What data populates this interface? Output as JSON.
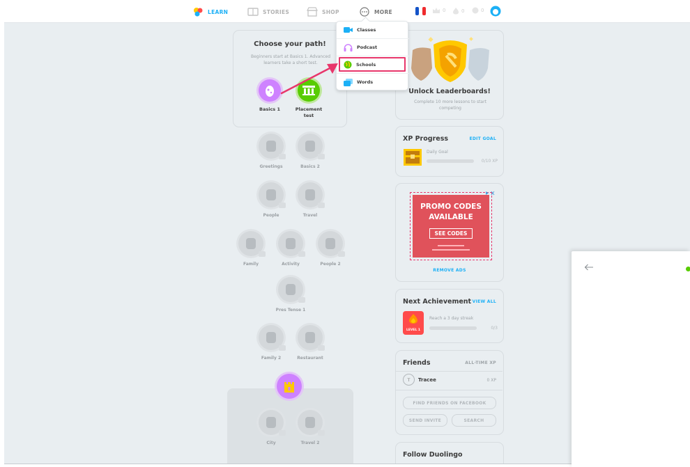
{
  "nav": {
    "learn": "LEARN",
    "stories": "STORIES",
    "shop": "SHOP",
    "more": "MORE",
    "stats": {
      "crowns": "0",
      "streak": "0",
      "gems": "0"
    }
  },
  "path": {
    "title": "Choose your path!",
    "subtitle": "Beginners start at Basics 1. Advanced learners take a short test.",
    "basics": "Basics 1",
    "placement": "Placement test"
  },
  "skills": [
    {
      "label": "Greetings"
    },
    {
      "label": "Basics 2"
    },
    {
      "label": "People"
    },
    {
      "label": "Travel"
    },
    {
      "label": "Family"
    },
    {
      "label": "Activity"
    },
    {
      "label": "People 2"
    },
    {
      "label": "Pres Tense 1"
    },
    {
      "label": "Family 2"
    },
    {
      "label": "Restaurant"
    },
    {
      "label": "City"
    },
    {
      "label": "Travel 2"
    }
  ],
  "dropdown": {
    "items": [
      "Classes",
      "Podcast",
      "Schools",
      "Words"
    ],
    "highlighted": "Schools"
  },
  "leaderboard": {
    "title": "Unlock Leaderboards!",
    "text": "Complete 10 more lessons to start competing"
  },
  "xp": {
    "title": "XP Progress",
    "edit": "EDIT GOAL",
    "goal_label": "Daily Goal",
    "value": "0/10 XP",
    "progress": 0
  },
  "ad": {
    "headline": "PROMO CODES AVAILABLE",
    "button": "SEE CODES",
    "remove": "REMOVE ADS"
  },
  "achievement": {
    "title": "Next Achievement",
    "link": "VIEW ALL",
    "badge": "LEVEL 1",
    "text": "Reach a 3 day streak",
    "value": "0/3"
  },
  "friends": {
    "title": "Friends",
    "link": "ALL-TIME XP",
    "initial": "T",
    "name": "Tracee",
    "xp": "0 XP",
    "facebook": "FIND FRIENDS ON FACEBOOK",
    "invite": "SEND INVITE",
    "search": "SEARCH"
  },
  "follow": {
    "title": "Follow Duolingo"
  },
  "colors": {
    "accent": "#1cb0f6",
    "highlight": "#e8366b",
    "green": "#58cc02",
    "purple": "#ce82ff"
  }
}
